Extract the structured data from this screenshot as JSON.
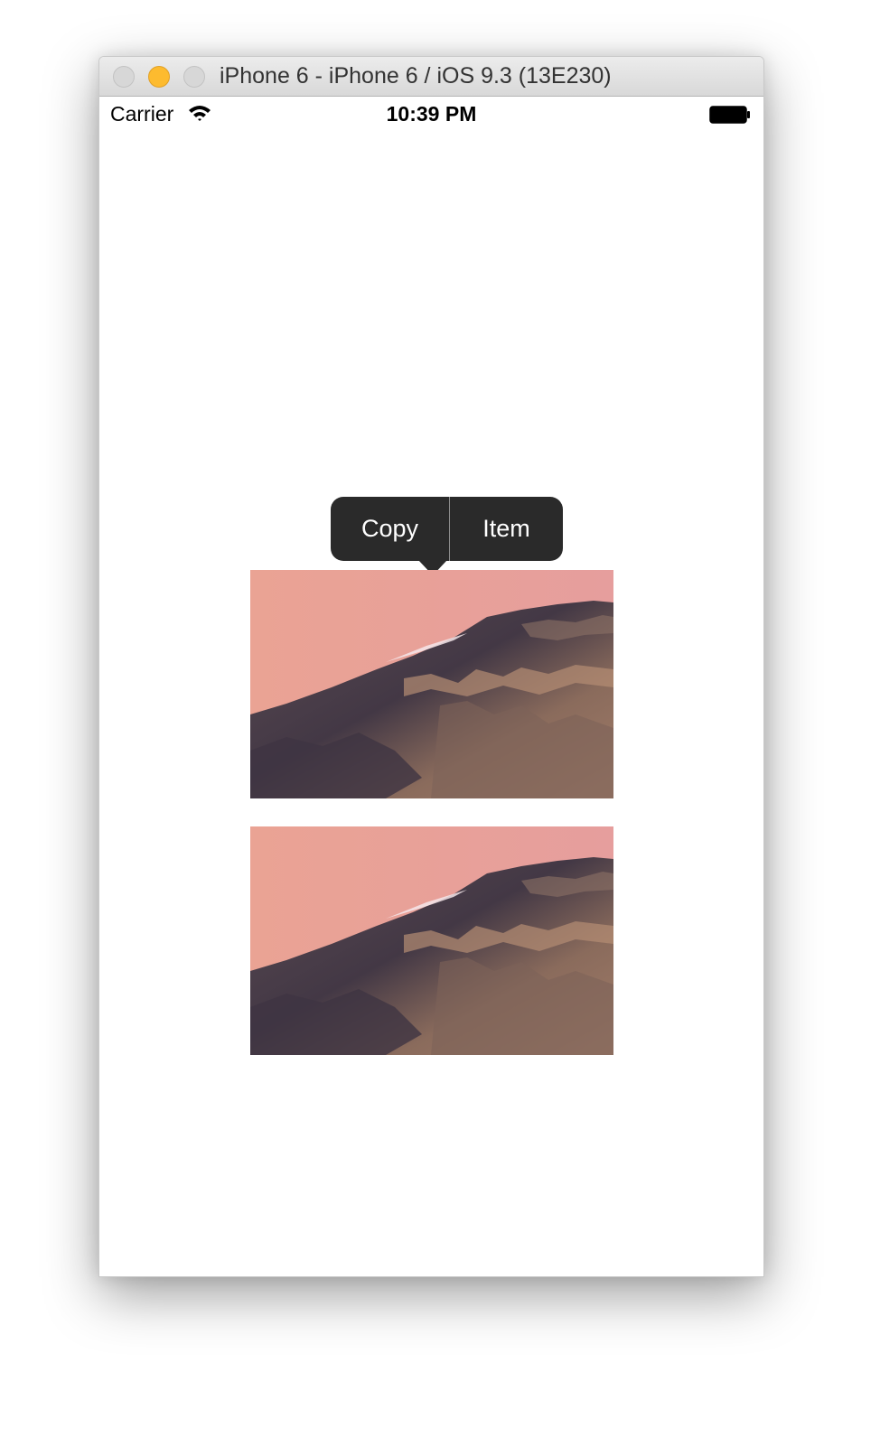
{
  "window": {
    "title": "iPhone 6 - iPhone 6 / iOS 9.3 (13E230)",
    "traffic_lights": [
      "close",
      "minimize",
      "zoom"
    ]
  },
  "statusbar": {
    "carrier": "Carrier",
    "time": "10:39 PM",
    "icons": [
      "wifi-icon",
      "battery-icon"
    ]
  },
  "context_menu": {
    "items": [
      {
        "label": "Copy"
      },
      {
        "label": "Item"
      }
    ],
    "background": "#2a2a2a"
  },
  "images": [
    {
      "subject": "mountain-cliff-at-sunset"
    },
    {
      "subject": "mountain-cliff-at-sunset"
    }
  ],
  "colors": {
    "sky": "#eda89b",
    "rock_dark": "#4b3f4a",
    "rock_light": "#9c7a66",
    "minimize_light": "#fdbb2f"
  }
}
